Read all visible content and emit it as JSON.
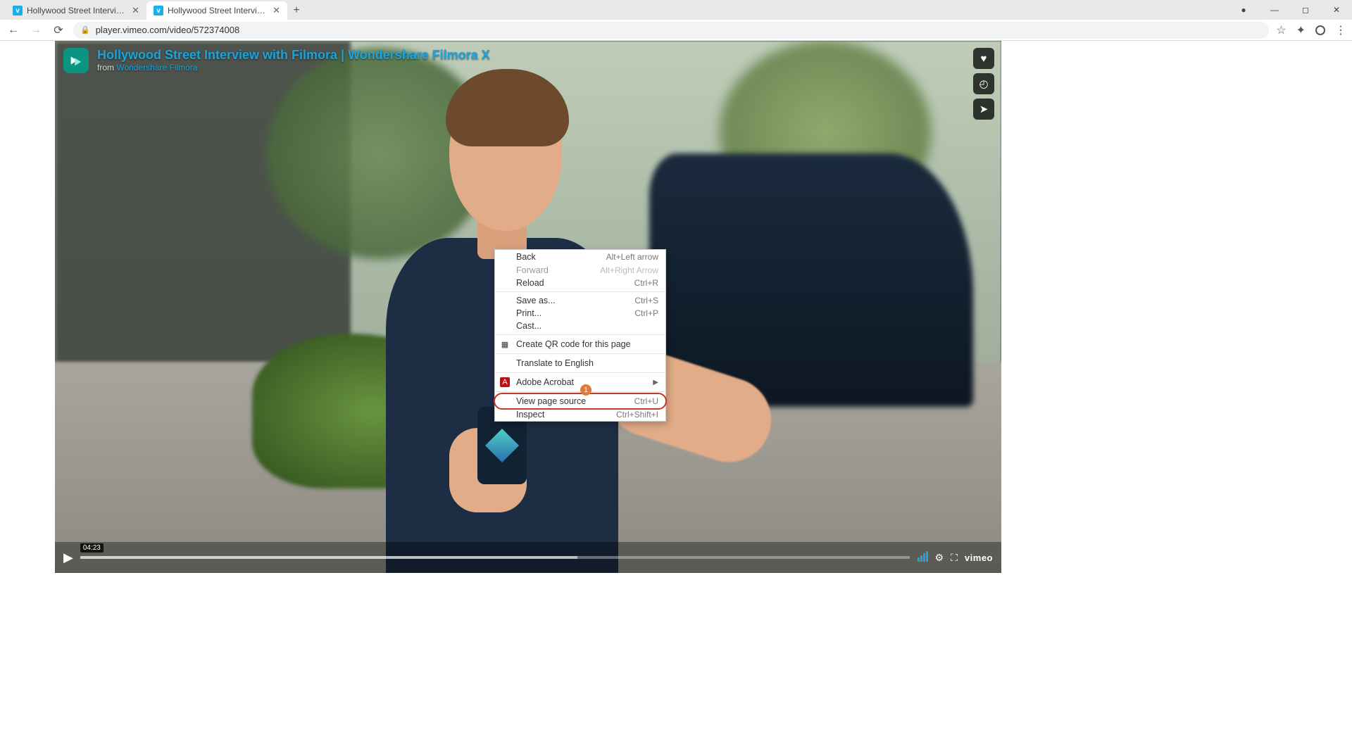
{
  "browser": {
    "tabs": [
      {
        "title": "Hollywood Street Interview with F",
        "active": false
      },
      {
        "title": "Hollywood Street Interview with F",
        "active": true
      }
    ],
    "url": "player.vimeo.com/video/572374008",
    "window_controls": {
      "recording": "●",
      "minimize": "—",
      "maximize": "◻",
      "close": "✕"
    },
    "nav_icons": {
      "back": "←",
      "forward": "→",
      "reload": "⟳",
      "lock": "🔒",
      "star": "☆",
      "ext": "✦",
      "profile": "◒",
      "menu": "⋮"
    }
  },
  "video": {
    "title": "Hollywood Street Interview with Filmora | Wondershare Filmora X",
    "from_label": "from ",
    "author": "Wondershare Filmora",
    "time_tooltip": "04:23",
    "brand": "vimeo",
    "icons": {
      "like": "♥",
      "watchlater": "◴",
      "share": "➤",
      "play": "▶",
      "gear": "⚙",
      "fullscreen": "⛶",
      "bars": ""
    }
  },
  "context_menu": {
    "items": [
      {
        "label": "Back",
        "shortcut": "Alt+Left arrow",
        "disabled": false
      },
      {
        "label": "Forward",
        "shortcut": "Alt+Right Arrow",
        "disabled": true
      },
      {
        "label": "Reload",
        "shortcut": "Ctrl+R",
        "disabled": false
      },
      "---",
      {
        "label": "Save as...",
        "shortcut": "Ctrl+S"
      },
      {
        "label": "Print...",
        "shortcut": "Ctrl+P"
      },
      {
        "label": "Cast..."
      },
      "---",
      {
        "label": "Create QR code for this page",
        "icon": "qr"
      },
      "---",
      {
        "label": "Translate to English"
      },
      "---",
      {
        "label": "Adobe Acrobat",
        "icon": "acrobat",
        "submenu": true
      },
      "---",
      {
        "label": "View page source",
        "shortcut": "Ctrl+U",
        "highlight": true
      },
      {
        "label": "Inspect",
        "shortcut": "Ctrl+Shift+I"
      }
    ],
    "annotation_badge": "1"
  }
}
